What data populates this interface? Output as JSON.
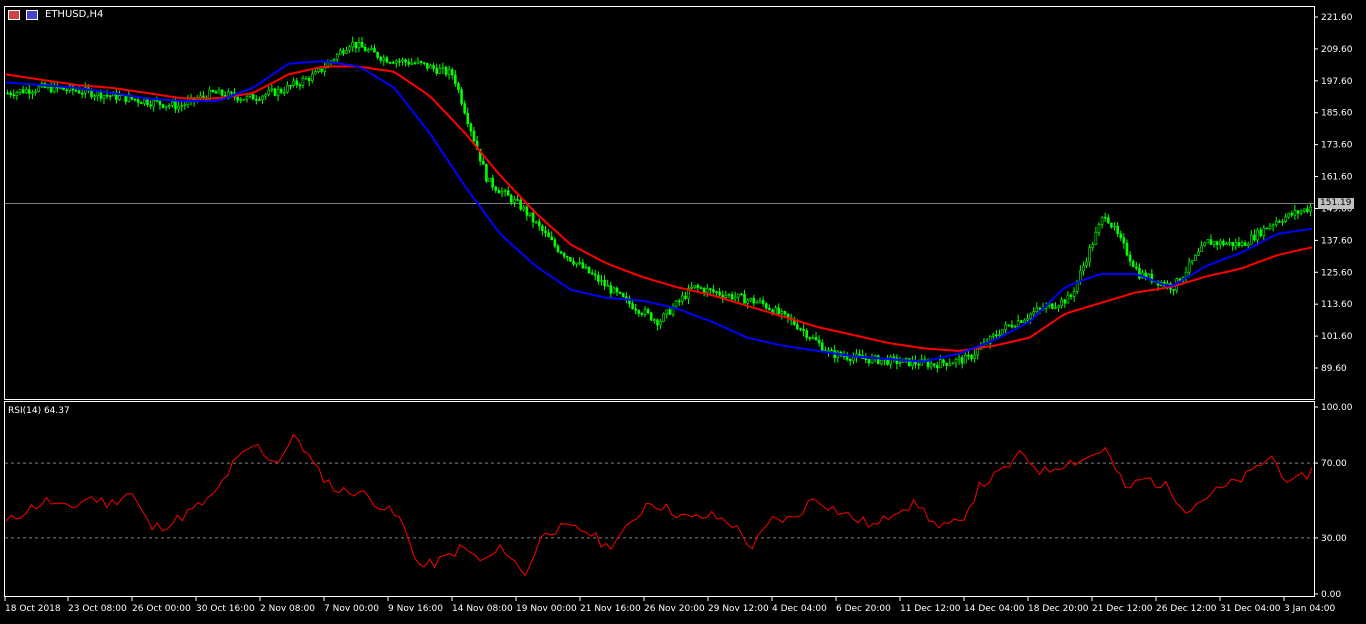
{
  "header": {
    "symbol": "ETHUSD,H4",
    "rsi_label": "RSI(14) 64.37",
    "current_price": "151.19"
  },
  "colors": {
    "candle": "#00ff00",
    "ma_fast": "#0000ff",
    "ma_slow": "#ff0000",
    "rsi": "#ff0000",
    "grid_line": "#808080"
  },
  "icons": [
    "chart-window-icon",
    "chart-properties-icon"
  ],
  "chart_data": [
    {
      "type": "line",
      "title": "ETHUSD,H4",
      "y_ticks": [
        "221.60",
        "209.60",
        "197.60",
        "185.60",
        "173.60",
        "161.60",
        "149.60",
        "137.60",
        "125.60",
        "113.60",
        "101.60",
        "89.60"
      ],
      "ylim": [
        83.6,
        223.6
      ],
      "current_price": 151.19,
      "x_ticks": [
        "18 Oct 2018",
        "23 Oct 08:00",
        "26 Oct 00:00",
        "30 Oct 16:00",
        "2 Nov 08:00",
        "7 Nov 00:00",
        "9 Nov 16:00",
        "14 Nov 08:00",
        "19 Nov 00:00",
        "21 Nov 16:00",
        "26 Nov 20:00",
        "29 Nov 12:00",
        "4 Dec 04:00",
        "6 Dec 20:00",
        "11 Dec 12:00",
        "14 Dec 04:00",
        "18 Dec 20:00",
        "21 Dec 12:00",
        "26 Dec 12:00",
        "31 Dec 04:00",
        "3 Jan 04:00"
      ],
      "series": [
        {
          "values": [
            193,
            195,
            194,
            192,
            190,
            188,
            193,
            191,
            194,
            200,
            212,
            206,
            204,
            200,
            160,
            150,
            135,
            125,
            115,
            107,
            120,
            117,
            114,
            106,
            95,
            93,
            92,
            91,
            93,
            104,
            111,
            116,
            148,
            125,
            120,
            137,
            136,
            145,
            150
          ]
        },
        {
          "values": [
            197,
            196,
            195,
            193,
            191,
            190,
            190,
            195,
            204,
            205,
            203,
            195,
            178,
            158,
            140,
            128,
            119,
            116,
            115,
            112,
            107,
            101,
            98,
            96,
            94,
            93,
            92,
            95,
            100,
            107,
            120,
            125,
            125,
            120,
            128,
            133,
            140,
            142
          ]
        },
        {
          "values": [
            200,
            198,
            196,
            195,
            193,
            191,
            191,
            193,
            200,
            203,
            203,
            201,
            192,
            178,
            162,
            148,
            136,
            129,
            124,
            120,
            117,
            113,
            109,
            105,
            102,
            99,
            97,
            96,
            98,
            101,
            110,
            114,
            118,
            120,
            124,
            127,
            132,
            135
          ]
        }
      ]
    },
    {
      "type": "line",
      "title": "RSI(14) 64.37",
      "y_ticks": [
        "100.00",
        "70.00",
        "30.00",
        "0.00"
      ],
      "ylim": [
        0,
        100
      ],
      "levels": [
        70,
        30
      ],
      "series": [
        {
          "values": [
            38,
            45,
            50,
            45,
            52,
            48,
            55,
            35,
            38,
            45,
            52,
            70,
            80,
            70,
            85,
            66,
            55,
            55,
            48,
            40,
            14,
            18,
            25,
            17,
            25,
            10,
            34,
            35,
            34,
            25,
            35,
            50,
            45,
            40,
            42,
            38,
            25,
            40,
            40,
            52,
            45,
            40,
            36,
            46,
            48,
            35,
            38,
            58,
            65,
            75,
            65,
            70,
            72,
            78,
            56,
            62,
            57,
            45,
            53,
            58,
            64,
            74,
            58,
            66
          ]
        }
      ]
    }
  ]
}
